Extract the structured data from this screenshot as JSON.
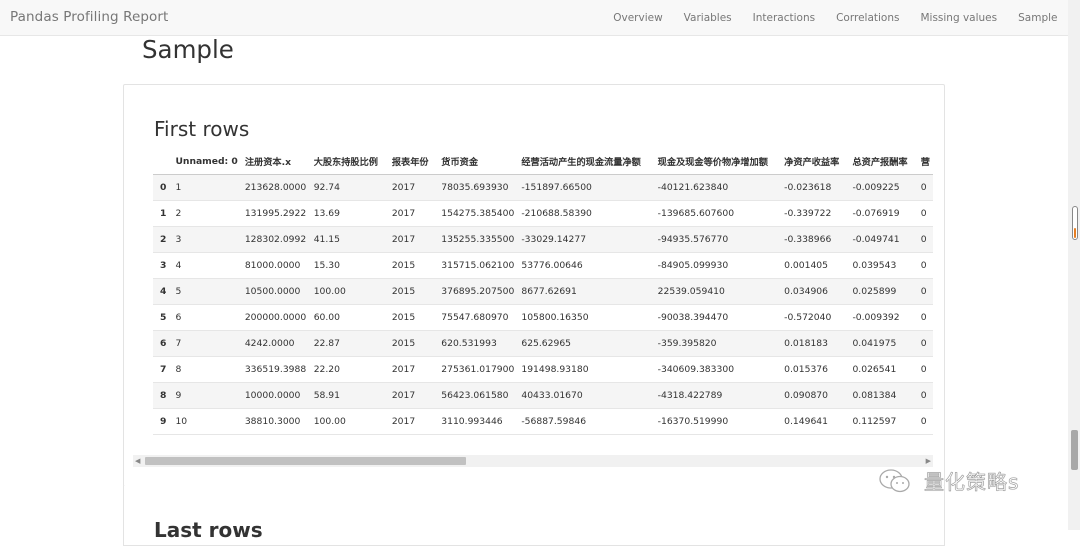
{
  "navbar": {
    "brand": "Pandas Profiling Report",
    "links": [
      "Overview",
      "Variables",
      "Interactions",
      "Correlations",
      "Missing values",
      "Sample"
    ]
  },
  "page_title": "Sample",
  "section": {
    "first_rows_title": "First rows",
    "last_rows_title": "Last rows"
  },
  "table": {
    "columns": [
      "",
      "Unnamed: 0",
      "注册资本.x",
      "大股东持股比例",
      "报表年份",
      "货币资金",
      "经营活动产生的现金流量净额",
      "现金及现金等价物净增加额",
      "净资产收益率",
      "总资产报酬率",
      "营"
    ],
    "rows": [
      [
        "0",
        "1",
        "213628.0000",
        "92.74",
        "2017",
        "78035.693930",
        "-151897.66500",
        "-40121.623840",
        "-0.023618",
        "-0.009225",
        "0"
      ],
      [
        "1",
        "2",
        "131995.2922",
        "13.69",
        "2017",
        "154275.385400",
        "-210688.58390",
        "-139685.607600",
        "-0.339722",
        "-0.076919",
        "0"
      ],
      [
        "2",
        "3",
        "128302.0992",
        "41.15",
        "2017",
        "135255.335500",
        "-33029.14277",
        "-94935.576770",
        "-0.338966",
        "-0.049741",
        "0"
      ],
      [
        "3",
        "4",
        "81000.0000",
        "15.30",
        "2015",
        "315715.062100",
        "53776.00646",
        "-84905.099930",
        "0.001405",
        "0.039543",
        "0"
      ],
      [
        "4",
        "5",
        "10500.0000",
        "100.00",
        "2015",
        "376895.207500",
        "8677.62691",
        "22539.059410",
        "0.034906",
        "0.025899",
        "0"
      ],
      [
        "5",
        "6",
        "200000.0000",
        "60.00",
        "2015",
        "75547.680970",
        "105800.16350",
        "-90038.394470",
        "-0.572040",
        "-0.009392",
        "0"
      ],
      [
        "6",
        "7",
        "4242.0000",
        "22.87",
        "2015",
        "620.531993",
        "625.62965",
        "-359.395820",
        "0.018183",
        "0.041975",
        "0"
      ],
      [
        "7",
        "8",
        "336519.3988",
        "22.20",
        "2017",
        "275361.017900",
        "191498.93180",
        "-340609.383300",
        "0.015376",
        "0.026541",
        "0"
      ],
      [
        "8",
        "9",
        "10000.0000",
        "58.91",
        "2017",
        "56423.061580",
        "40433.01670",
        "-4318.422789",
        "0.090870",
        "0.081384",
        "0"
      ],
      [
        "9",
        "10",
        "38810.3000",
        "100.00",
        "2017",
        "3110.993446",
        "-56887.59846",
        "-16370.519990",
        "0.149641",
        "0.112597",
        "0"
      ]
    ]
  },
  "watermark": {
    "text": "量化策略s",
    "icon": "wechat-icon"
  },
  "colors": {
    "navbar_bg": "#f8f8f8",
    "stripe": "#f5f5f5",
    "scroll_thumb": "#c1c1c1",
    "accent": "#e67e22"
  }
}
